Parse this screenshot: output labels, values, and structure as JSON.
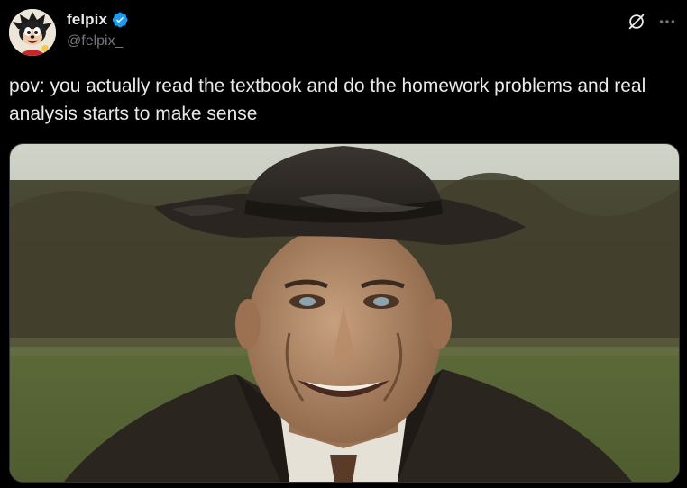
{
  "author": {
    "display_name": "felpix",
    "handle": "@felpix_",
    "verified": true,
    "avatar_icon": "cartoon-character-avatar"
  },
  "actions": {
    "grok_icon": "grok-icon",
    "more_icon": "more-options-icon"
  },
  "post": {
    "text": "pov: you actually read the textbook and do the homework problems and real analysis starts to make sense"
  },
  "media": {
    "icon": "photo-image"
  },
  "colors": {
    "background": "#000000",
    "text_primary": "#e7e9ea",
    "text_secondary": "#71767b",
    "verified_blue": "#1d9bf0",
    "border": "#2f3336"
  }
}
